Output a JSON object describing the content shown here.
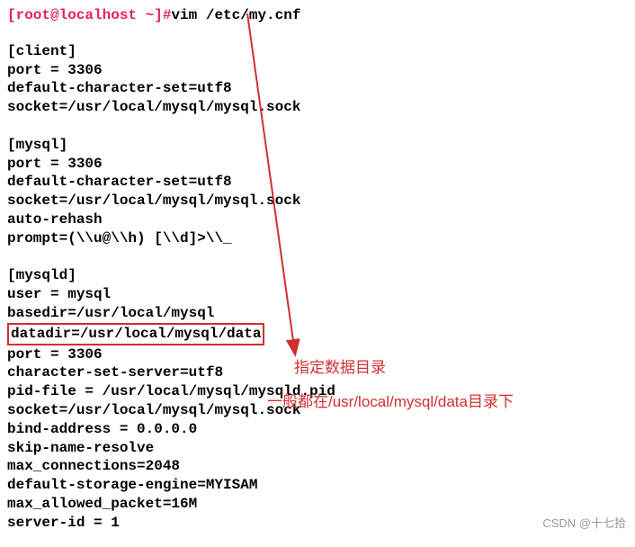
{
  "prompt": {
    "bracket": "[root@localhost ~]#",
    "command": "vim /etc/my.cnf"
  },
  "config": {
    "client_header": "[client]",
    "client_port": "port = 3306",
    "client_charset": "default-character-set=utf8",
    "client_socket": "socket=/usr/local/mysql/mysql.sock",
    "mysql_header": "[mysql]",
    "mysql_port": "port = 3306",
    "mysql_charset": "default-character-set=utf8",
    "mysql_socket": "socket=/usr/local/mysql/mysql.sock",
    "mysql_autorehash": "auto-rehash",
    "mysql_prompt": "prompt=(\\\\u@\\\\h) [\\\\d]>\\\\_",
    "mysqld_header": "[mysqld]",
    "mysqld_user": "user = mysql",
    "mysqld_basedir": "basedir=/usr/local/mysql",
    "mysqld_datadir": "datadir=/usr/local/mysql/data",
    "mysqld_port": "port = 3306",
    "mysqld_charserver": "character-set-server=utf8",
    "mysqld_pidfile": "pid-file = /usr/local/mysql/mysqld.pid",
    "mysqld_socket": "socket=/usr/local/mysql/mysql.sock",
    "mysqld_bind": "bind-address = 0.0.0.0",
    "mysqld_skip": "skip-name-resolve",
    "mysqld_maxconn": "max_connections=2048",
    "mysqld_engine": "default-storage-engine=MYISAM",
    "mysqld_packet": "max_allowed_packet=16M",
    "mysqld_serverid": "server-id = 1"
  },
  "annotations": {
    "label1": "指定数据目录",
    "label2": "一般都在/usr/local/mysql/data目录下"
  },
  "watermark": "CSDN @十七拾"
}
